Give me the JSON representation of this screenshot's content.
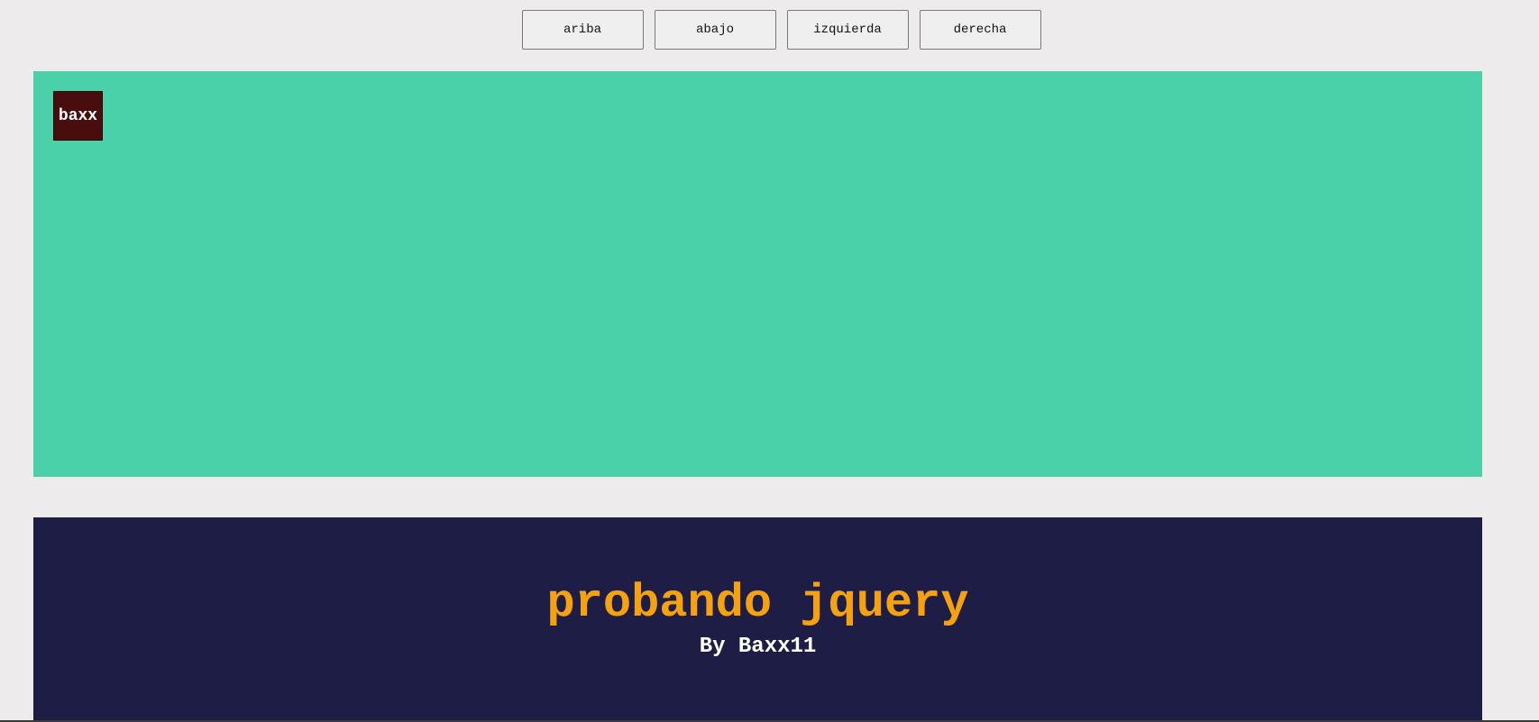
{
  "controls": {
    "up_label": "ariba",
    "down_label": "abajo",
    "left_label": "izquierda",
    "right_label": "derecha"
  },
  "stage": {
    "background_color": "#4ad1a9",
    "box": {
      "label": "baxx",
      "color": "#4a0d0d"
    }
  },
  "banner": {
    "title": "probando jquery",
    "subtitle": "By Baxx11",
    "background_color": "#1e1d45",
    "title_color": "#f6a20f"
  }
}
